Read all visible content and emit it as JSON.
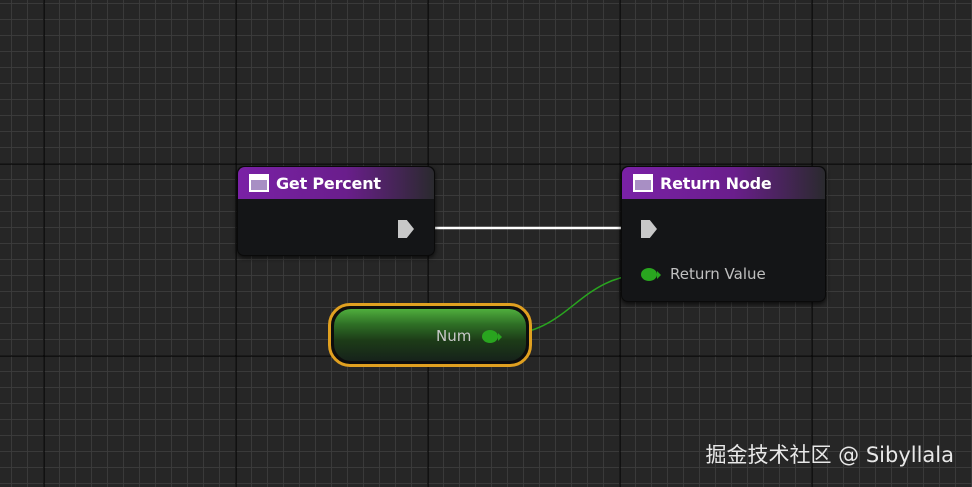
{
  "graph": {
    "nodes": {
      "get_percent": {
        "title": "Get Percent",
        "icon": "function-icon"
      },
      "return_node": {
        "title": "Return Node",
        "icon": "function-icon",
        "return_value_label": "Return Value"
      },
      "variable": {
        "label": "Num"
      }
    },
    "colors": {
      "header_purple": "#7a21a6",
      "pin_green": "#29a51f",
      "exec_gray": "#c8c8c8",
      "selection_orange": "#e0a020",
      "background": "#262626"
    }
  },
  "watermark": "掘金技术社区 @ Sibyllala"
}
